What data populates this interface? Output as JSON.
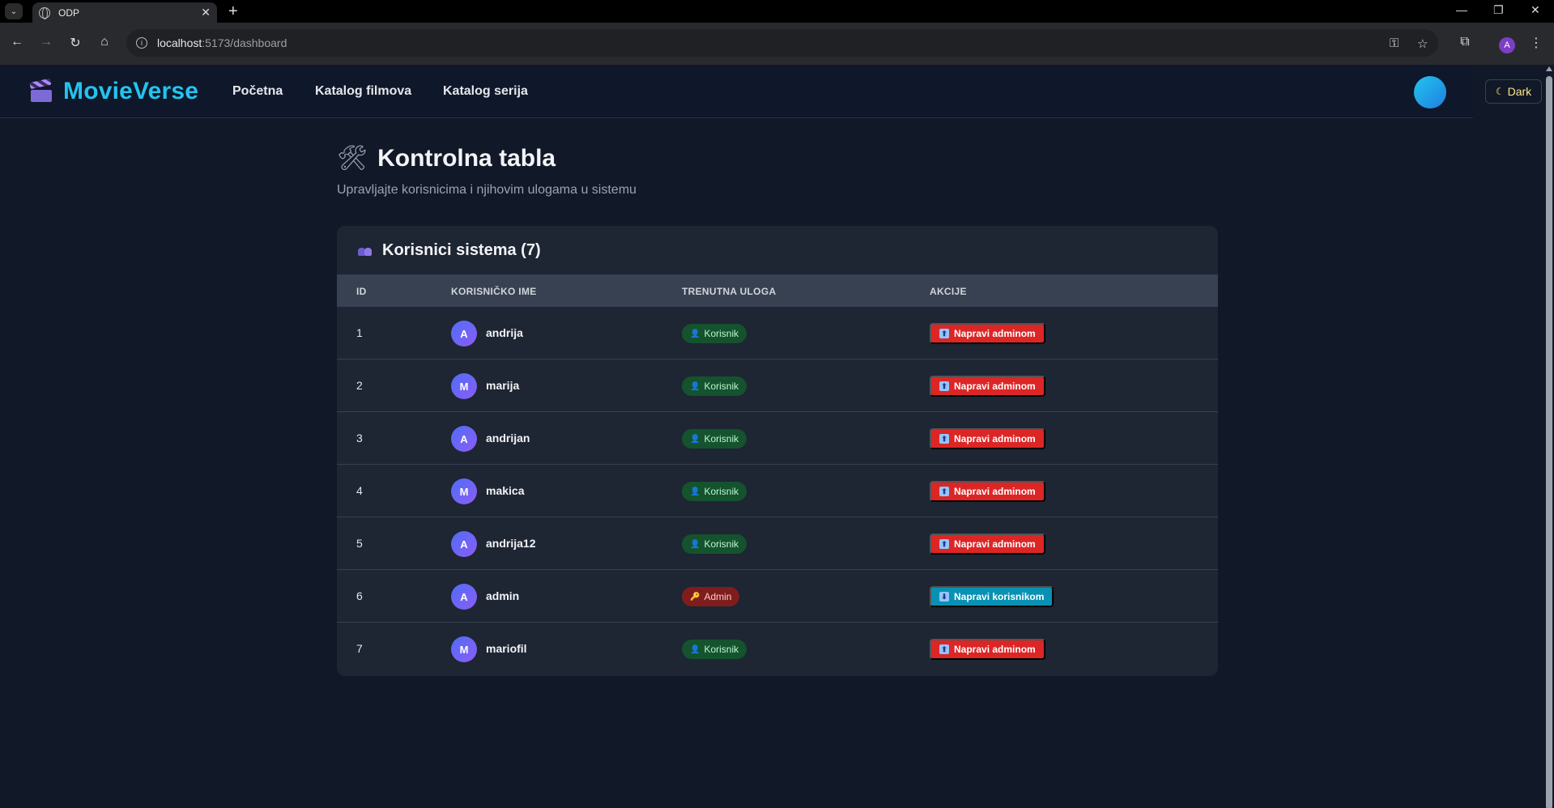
{
  "browser": {
    "tab_title": "ODP",
    "url_host": "localhost",
    "url_rest": ":5173/dashboard",
    "profile_initial": "A"
  },
  "app": {
    "brand": "MovieVerse",
    "nav": [
      "Početna",
      "Katalog filmova",
      "Katalog serija"
    ],
    "theme_label": "Dark"
  },
  "page": {
    "title": "Kontrolna tabla",
    "subtitle": "Upravljajte korisnicima i njihovim ulogama u sistemu"
  },
  "table": {
    "title": "Korisnici sistema (7)",
    "headers": [
      "ID",
      "KORISNIČKO IME",
      "TRENUTNA ULOGA",
      "AKCIJE"
    ],
    "rows": [
      {
        "id": "1",
        "initial": "A",
        "username": "andrija",
        "role": "Korisnik",
        "action": "Napravi adminom"
      },
      {
        "id": "2",
        "initial": "M",
        "username": "marija",
        "role": "Korisnik",
        "action": "Napravi adminom"
      },
      {
        "id": "3",
        "initial": "A",
        "username": "andrijan",
        "role": "Korisnik",
        "action": "Napravi adminom"
      },
      {
        "id": "4",
        "initial": "M",
        "username": "makica",
        "role": "Korisnik",
        "action": "Napravi adminom"
      },
      {
        "id": "5",
        "initial": "A",
        "username": "andrija12",
        "role": "Korisnik",
        "action": "Napravi adminom"
      },
      {
        "id": "6",
        "initial": "A",
        "username": "admin",
        "role": "Admin",
        "action": "Napravi korisnikom"
      },
      {
        "id": "7",
        "initial": "M",
        "username": "mariofil",
        "role": "Korisnik",
        "action": "Napravi adminom"
      }
    ]
  },
  "colors": {
    "background": "#111827",
    "brand": "#22c4ee",
    "promote_button": "#dc2626",
    "demote_button": "#0891b2",
    "user_badge": "#14532d",
    "admin_badge": "#7f1d1d"
  }
}
